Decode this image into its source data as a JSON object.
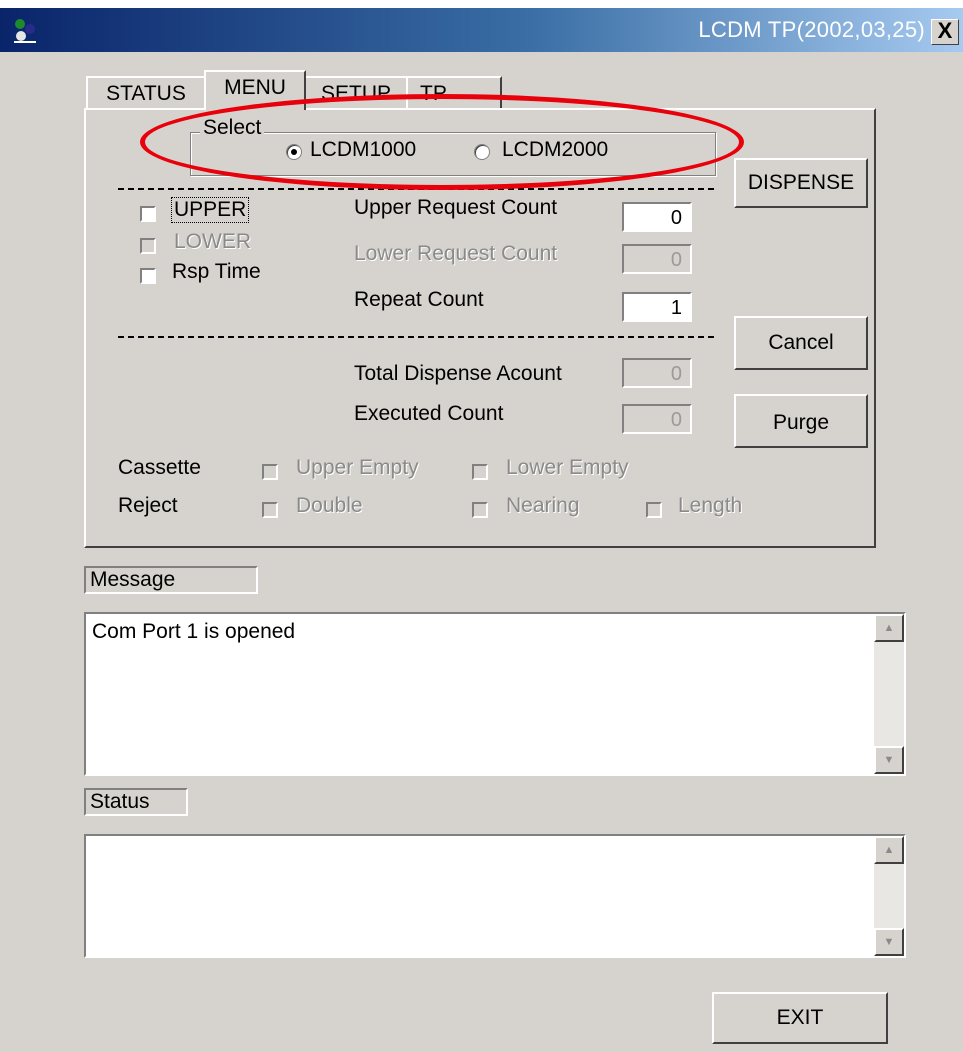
{
  "window": {
    "title": "LCDM TP(2002,03,25)",
    "close_label": "X",
    "icon": "app-icon"
  },
  "tabs": [
    {
      "label": "STATUS",
      "active": false
    },
    {
      "label": "MENU",
      "active": true
    },
    {
      "label": "SETUP",
      "active": false
    },
    {
      "label": "TP",
      "active": false
    }
  ],
  "select_group": {
    "legend": "Select",
    "options": [
      {
        "label": "LCDM1000",
        "selected": true
      },
      {
        "label": "LCDM2000",
        "selected": false
      }
    ]
  },
  "checks": {
    "upper": {
      "label": "UPPER",
      "checked": false,
      "enabled": true
    },
    "lower": {
      "label": "LOWER",
      "checked": false,
      "enabled": false
    },
    "rsp_time": {
      "label": "Rsp Time",
      "checked": false,
      "enabled": true
    }
  },
  "fields": {
    "upper_request": {
      "label": "Upper Request Count",
      "value": "0",
      "enabled": true
    },
    "lower_request": {
      "label": "Lower Request Count",
      "value": "0",
      "enabled": false
    },
    "repeat": {
      "label": "Repeat Count",
      "value": "1",
      "enabled": true
    },
    "total_dispense": {
      "label": "Total Dispense Acount",
      "value": "0",
      "enabled": false
    },
    "executed": {
      "label": "Executed Count",
      "value": "0",
      "enabled": false
    }
  },
  "buttons": {
    "dispense": "DISPENSE",
    "cancel": "Cancel",
    "purge": "Purge",
    "exit": "EXIT"
  },
  "cassette": {
    "label": "Cassette",
    "items": [
      {
        "label": "Upper Empty",
        "checked": false
      },
      {
        "label": "Lower Empty",
        "checked": false
      }
    ]
  },
  "reject": {
    "label": "Reject",
    "items": [
      {
        "label": "Double",
        "checked": false
      },
      {
        "label": "Nearing",
        "checked": false
      },
      {
        "label": "Length",
        "checked": false
      }
    ]
  },
  "message": {
    "caption": "Message",
    "text": "Com Port 1 is opened"
  },
  "status": {
    "caption": "Status",
    "text": ""
  },
  "colors": {
    "highlight": "#e8000b",
    "face": "#d6d3ce",
    "title_start": "#0a246a",
    "title_end": "#a6caf0"
  }
}
